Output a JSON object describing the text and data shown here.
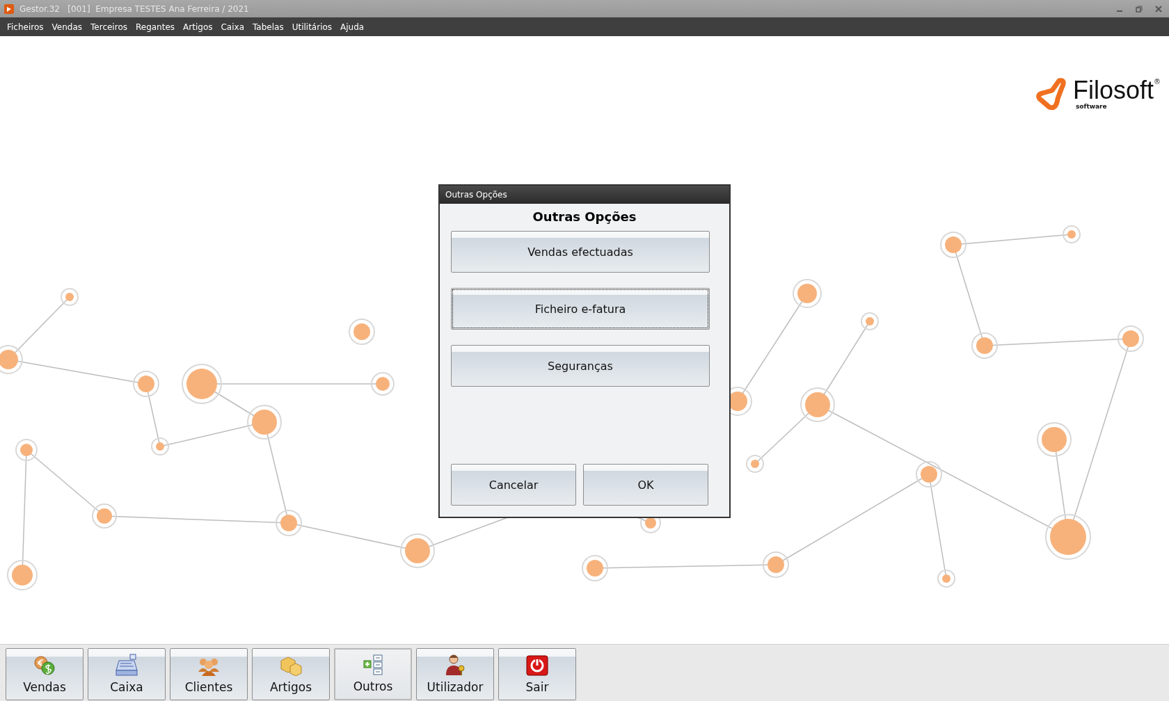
{
  "window": {
    "title": "Gestor.32   [001]  Empresa TESTES Ana Ferreira / 2021"
  },
  "menu": [
    "Ficheiros",
    "Vendas",
    "Terceiros",
    "Regantes",
    "Artigos",
    "Caixa",
    "Tabelas",
    "Utilitários",
    "Ajuda"
  ],
  "logo": {
    "name": "Filosoft",
    "tagline": "software",
    "mark": "®"
  },
  "dialog": {
    "title": "Outras Opções",
    "heading": "Outras Opções",
    "options": [
      {
        "label": "Vendas efectuadas",
        "focused": false
      },
      {
        "label": "Ficheiro e-fatura",
        "focused": true
      },
      {
        "label": "Seguranças",
        "focused": false
      }
    ],
    "buttons": [
      "Cancelar",
      "OK"
    ]
  },
  "toolbar": [
    {
      "label": "Vendas",
      "kind": "coins",
      "selected": false
    },
    {
      "label": "Caixa",
      "kind": "register",
      "selected": false
    },
    {
      "label": "Clientes",
      "kind": "people",
      "selected": false
    },
    {
      "label": "Artigos",
      "kind": "boxes",
      "selected": false
    },
    {
      "label": "Outros",
      "kind": "list",
      "selected": true
    },
    {
      "label": "Utilizador",
      "kind": "user",
      "selected": false
    },
    {
      "label": "Sair",
      "kind": "power",
      "selected": false
    }
  ]
}
